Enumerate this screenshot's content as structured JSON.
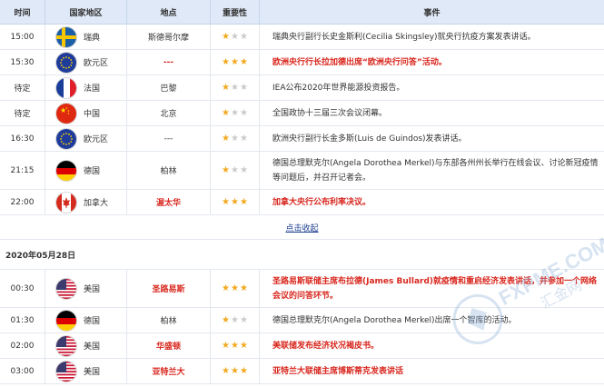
{
  "header": {
    "time": "时间",
    "country": "国家地区",
    "location": "地点",
    "importance": "重要性",
    "event": "事件"
  },
  "day1_rows": [
    {
      "time": "15:00",
      "country": "瑞典",
      "flag": "sweden",
      "location": "斯德哥尔摩",
      "stars": 1,
      "event": "瑞典央行副行长史金斯利(Cecilia Skingsley)就央行抗疫方案发表讲话。",
      "highlight": false
    },
    {
      "time": "15:30",
      "country": "欧元区",
      "flag": "eu",
      "location": "---",
      "stars": 3,
      "event": "欧洲央行行长拉加德出席“欧洲央行问答”活动。",
      "highlight": true
    },
    {
      "time": "待定",
      "country": "法国",
      "flag": "france",
      "location": "巴黎",
      "stars": 1,
      "event": "IEA公布2020年世界能源投资报告。",
      "highlight": false
    },
    {
      "time": "待定",
      "country": "中国",
      "flag": "china",
      "location": "北京",
      "stars": 1,
      "event": "全国政协十三届三次会议闭幕。",
      "highlight": false
    },
    {
      "time": "16:30",
      "country": "欧元区",
      "flag": "eu",
      "location": "---",
      "stars": 1,
      "event": "欧洲央行副行长金多斯(Luis de Guindos)发表讲话。",
      "highlight": false
    },
    {
      "time": "21:15",
      "country": "德国",
      "flag": "germany",
      "location": "柏林",
      "stars": 1,
      "event": "德国总理默克尔(Angela Dorothea Merkel)与东部各州州长举行在线会议、讨论新冠疫情等问题后，并召开记者会。",
      "highlight": false
    },
    {
      "time": "22:00",
      "country": "加拿大",
      "flag": "canada",
      "location": "渥太华",
      "stars": 3,
      "event": "加拿大央行公布利率决议。",
      "highlight": true
    }
  ],
  "collapse_label": "点击收起",
  "date_label": "2020年05月28日",
  "day2_rows": [
    {
      "time": "00:30",
      "country": "美国",
      "flag": "usa",
      "location": "圣路易斯",
      "stars": 3,
      "event": "圣路易斯联储主席布拉德(James Bullard)就疫情和重启经济发表讲话，并参加一个网络会议的问答环节。",
      "highlight": true
    },
    {
      "time": "01:30",
      "country": "德国",
      "flag": "germany",
      "location": "柏林",
      "stars": 1,
      "event": "德国总理默克尔(Angela Dorothea Merkel)出席一个智库的活动。",
      "highlight": false
    },
    {
      "time": "02:00",
      "country": "美国",
      "flag": "usa",
      "location": "华盛顿",
      "stars": 3,
      "event": "美联储发布经济状况褐皮书。",
      "highlight": true
    },
    {
      "time": "03:00",
      "country": "美国",
      "flag": "usa",
      "location": "亚特兰大",
      "stars": 3,
      "event": "亚特兰大联储主席博斯蒂克发表讲话",
      "highlight": true
    }
  ],
  "watermark": {
    "text1": "FXPME.COM",
    "text2": "汇金网"
  },
  "colors": {
    "highlight": "#d8261d",
    "star_on": "#f2a81d",
    "star_off": "#c9c9c9",
    "header_bg": "#dfe9f7"
  }
}
